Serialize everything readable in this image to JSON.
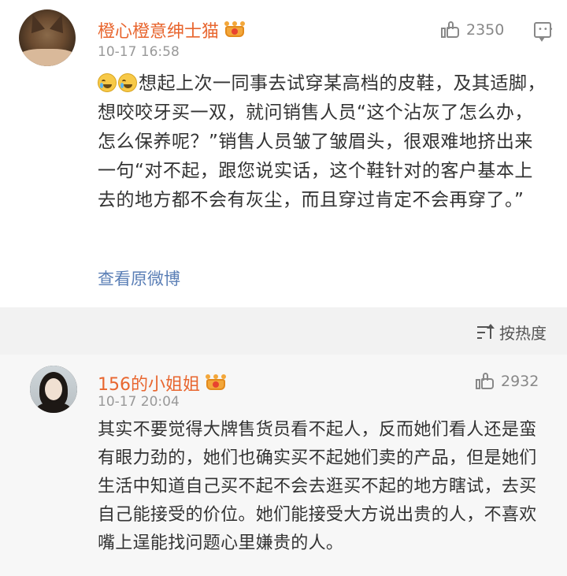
{
  "post": {
    "username": "橙心橙意绅士猫",
    "timestamp": "10-17 16:58",
    "like_count": "2350",
    "text": "想起上次一同事去试穿某高档的皮鞋，及其适脚，想咬咬牙买一双，就问销售人员“这个沾灰了怎么办，怎么保养呢？”销售人员皱了皱眉头，很艰难地挤出来一句“对不起，跟您说实话，这个鞋针对的客户基本上去的地方都不会有灰尘，而且穿过肯定不会再穿了。”",
    "view_original": "查看原微博",
    "icons": [
      "cat-avatar",
      "vip-crown-icon",
      "thumbs-up-icon",
      "comment-icon",
      "laugh-cry-emoji"
    ]
  },
  "sort": {
    "label": "按热度"
  },
  "comment": {
    "username": "156的小姐姐",
    "timestamp": "10-17 20:04",
    "like_count": "2932",
    "text": "其实不要觉得大牌售货员看不起人，反而她们看人还是蛮有眼力劲的，她们也确实买不起她们卖的产品，但是她们生活中知道自己买不起不会去逛买不起的地方瞎试，去买自己能接受的价位。她们能接受大方说出贵的人，不喜欢嘴上逞能找问题心里嫌贵的人。"
  },
  "colors": {
    "username": "#e8662f",
    "link": "#5b7fb6",
    "meta": "#999999",
    "text": "#333333",
    "band": "#f2f2f2"
  }
}
